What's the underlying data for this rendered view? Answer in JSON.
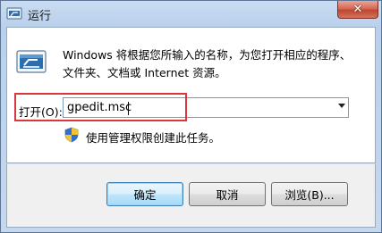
{
  "window": {
    "title": "运行",
    "close_glyph": "✕"
  },
  "main": {
    "description": "Windows 将根据您所输入的名称，为您打开相应的程序、文件夹、文档或 Internet 资源。",
    "open_label": "打开(O):",
    "open_value": "gpedit.msc",
    "admin_note": "使用管理权限创建此任务。",
    "run_icon": "run-program-icon",
    "shield_icon": "uac-shield-icon"
  },
  "buttons": {
    "ok": "确定",
    "cancel": "取消",
    "browse": "浏览(B)..."
  },
  "colors": {
    "highlight": "#d9363e",
    "close_button": "#c0462f",
    "default_button_border": "#3c7fb1"
  }
}
